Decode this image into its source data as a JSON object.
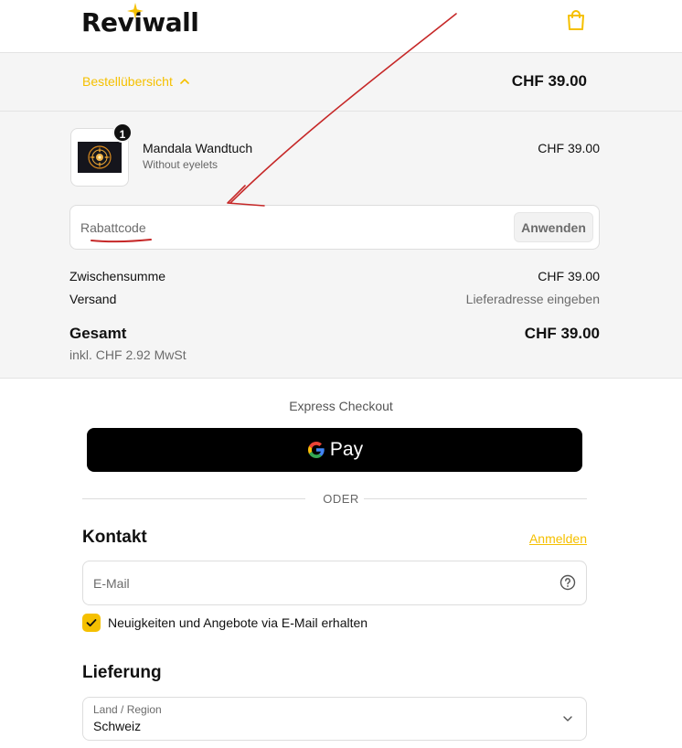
{
  "header": {
    "logo_text": "Reviwall",
    "cart_icon": "shopping-bag-icon"
  },
  "summary": {
    "toggle_label": "Bestellübersicht",
    "total": "CHF 39.00"
  },
  "order": {
    "item": {
      "quantity": "1",
      "name": "Mandala Wandtuch",
      "variant": "Without eyelets",
      "price": "CHF 39.00"
    },
    "discount": {
      "placeholder": "Rabattcode",
      "apply_label": "Anwenden"
    },
    "subtotal_label": "Zwischensumme",
    "subtotal_value": "CHF 39.00",
    "shipping_label": "Versand",
    "shipping_value": "Lieferadresse eingeben",
    "total_label": "Gesamt",
    "total_value": "CHF 39.00",
    "tax_note": "inkl. CHF 2.92 MwSt"
  },
  "checkout": {
    "express_title": "Express Checkout",
    "gpay_label": "Pay",
    "divider_text": "ODER",
    "contact": {
      "title": "Kontakt",
      "login_link": "Anmelden",
      "email_placeholder": "E-Mail",
      "newsletter_label": "Neuigkeiten und Angebote via E-Mail erhalten",
      "newsletter_checked": true
    },
    "delivery": {
      "title": "Lieferung",
      "country_label": "Land / Region",
      "country_value": "Schweiz"
    }
  },
  "colors": {
    "accent": "#f5c000",
    "annotation": "#c62828",
    "button_bg": "#000000"
  }
}
